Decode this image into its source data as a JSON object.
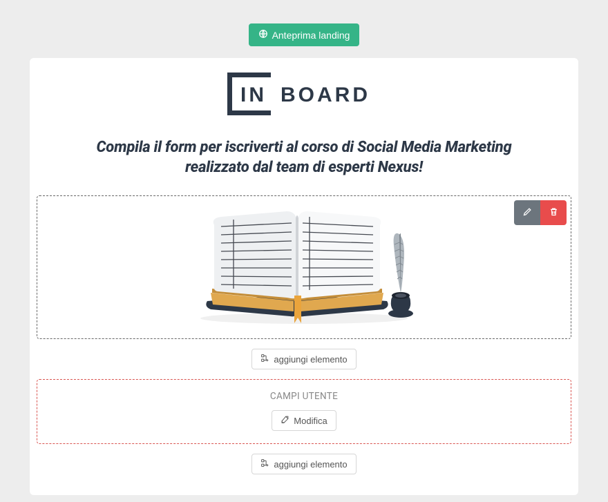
{
  "preview_button": "Anteprima landing",
  "logo": {
    "text_in": "IN",
    "text_board": "BOARD"
  },
  "heading_line1": "Compila il form per iscriverti al corso di Social Media Marketing",
  "heading_line2": "realizzato dal team di esperti Nexus!",
  "add_element_label": "aggiungi elemento",
  "user_fields_label": "CAMPI UTENTE",
  "modify_label": "Modifica"
}
